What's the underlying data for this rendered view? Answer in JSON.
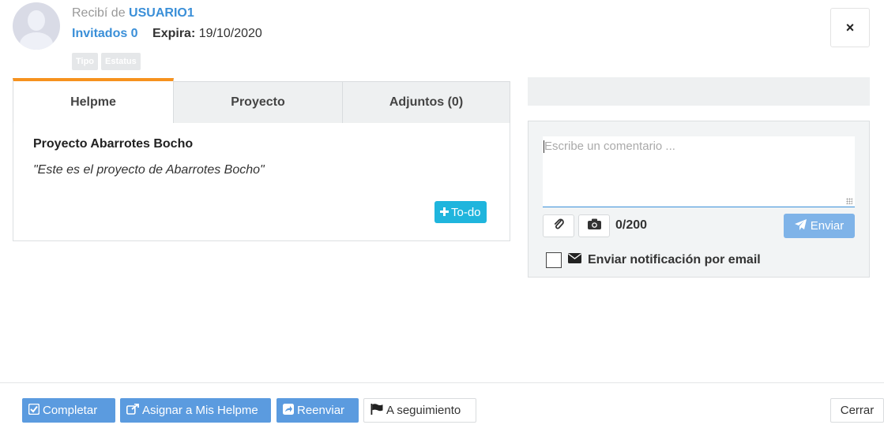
{
  "header": {
    "from_prefix": "Recibí de",
    "from_user": "USUARIO1",
    "invited": "Invitados 0",
    "expires_label": "Expira:",
    "expires_value": "19/10/2020",
    "tags": [
      "Tipo",
      "Estatus"
    ],
    "close_symbol": "×"
  },
  "tabs": [
    {
      "label": "Helpme",
      "active": true
    },
    {
      "label": "Proyecto",
      "active": false
    },
    {
      "label": "Adjuntos (0)",
      "active": false
    }
  ],
  "panel": {
    "title": "Proyecto Abarrotes Bocho",
    "quote": "\"Este es el proyecto de Abarrotes Bocho\"",
    "todo_label": "To-do"
  },
  "comment": {
    "placeholder": "Escribe un comentario ...",
    "counter": "0/200",
    "send_label": "Enviar",
    "notify_label": "Enviar notificación por email"
  },
  "footer": {
    "complete_label": "Completar",
    "assign_label": "Asignar a Mis Helpme",
    "forward_label": "Reenviar",
    "follow_label": "A seguimiento",
    "close_label": "Cerrar"
  },
  "icons": [
    "avatar-icon",
    "close-icon",
    "plus-icon",
    "paperclip-icon",
    "camera-icon",
    "send-icon",
    "envelope-icon",
    "check-square-icon",
    "external-link-icon",
    "share-icon",
    "flag-icon"
  ],
  "colors": {
    "accent": "#3a8fd8",
    "tab_active": "#f6921e",
    "todo": "#1fb5dd",
    "button_blue": "#5b9bdf"
  }
}
